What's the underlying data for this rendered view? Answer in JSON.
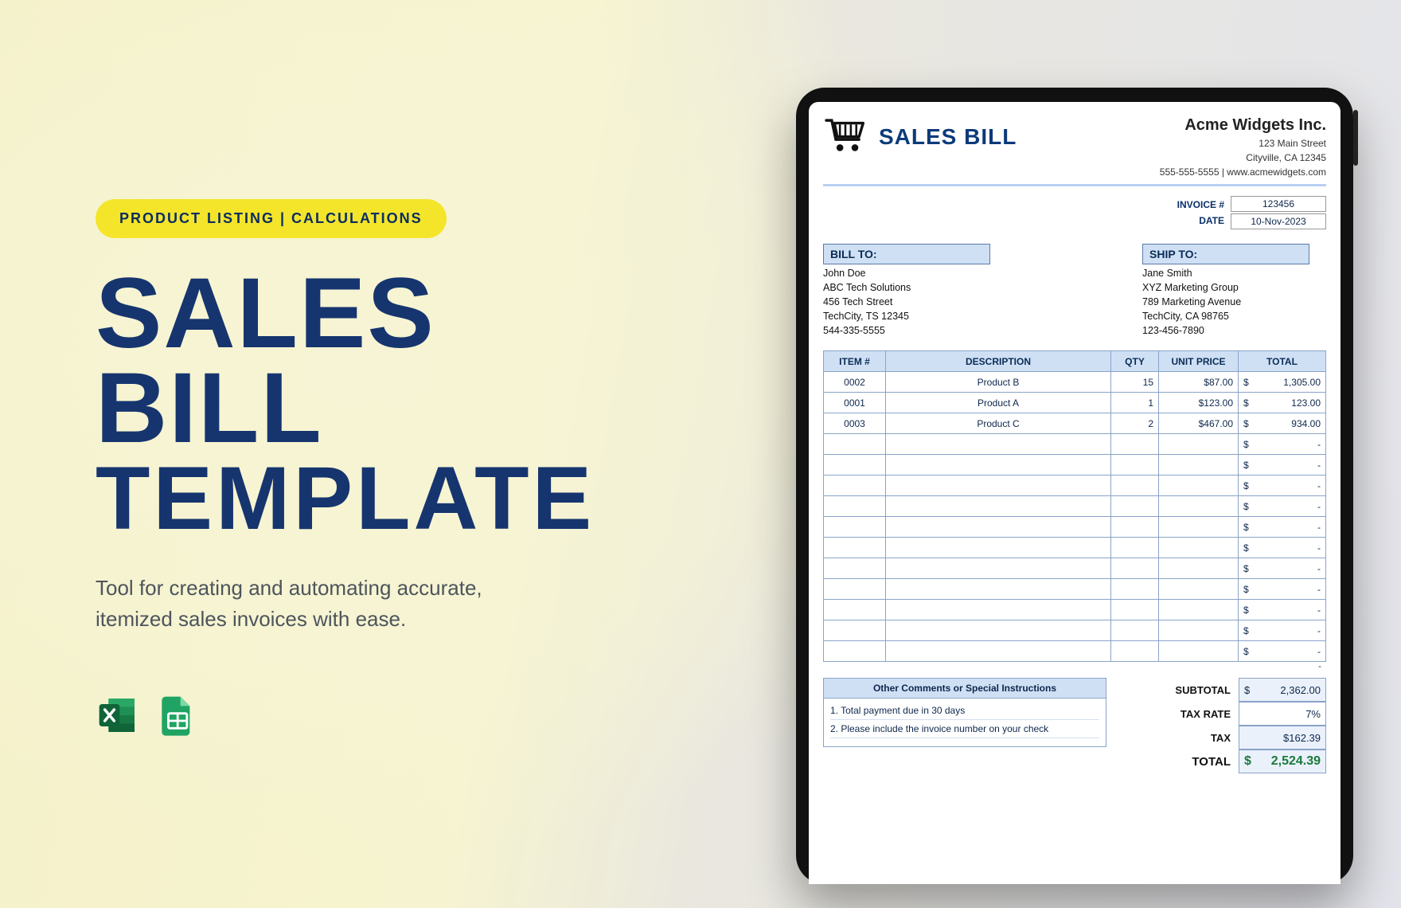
{
  "promo": {
    "pill": "PRODUCT LISTING  |  CALCULATIONS",
    "title_line1": "SALES BILL",
    "title_line2": "TEMPLATE",
    "subtitle": "Tool for creating and automating accurate, itemized sales invoices with ease."
  },
  "apps": {
    "a": "excel-icon",
    "b": "sheets-icon"
  },
  "doc": {
    "title": "SALES BILL",
    "company": {
      "name": "Acme Widgets Inc.",
      "street": "123 Main Street",
      "citystate": "Cityville, CA 12345",
      "contact": "555-555-5555 | www.acmewidgets.com"
    },
    "meta": {
      "invoice_label": "INVOICE #",
      "date_label": "DATE",
      "invoice_no": "123456",
      "date": "10-Nov-2023"
    },
    "billto": {
      "head": "BILL TO:",
      "name": "John Doe",
      "org": "ABC Tech Solutions",
      "street": "456 Tech Street",
      "citystate": "TechCity, TS 12345",
      "phone": "544-335-5555"
    },
    "shipto": {
      "head": "SHIP TO:",
      "name": "Jane Smith",
      "org": "XYZ Marketing Group",
      "street": "789 Marketing Avenue",
      "citystate": "TechCity, CA 98765",
      "phone": "123-456-7890"
    },
    "table": {
      "headers": {
        "item": "ITEM #",
        "desc": "DESCRIPTION",
        "qty": "QTY",
        "unit": "UNIT PRICE",
        "total": "TOTAL"
      },
      "rows": [
        {
          "item": "0002",
          "desc": "Product B",
          "qty": "15",
          "unit": "$87.00",
          "total": "1,305.00"
        },
        {
          "item": "0001",
          "desc": "Product A",
          "qty": "1",
          "unit": "$123.00",
          "total": "123.00"
        },
        {
          "item": "0003",
          "desc": "Product C",
          "qty": "2",
          "unit": "$467.00",
          "total": "934.00"
        }
      ],
      "blank_total": "-",
      "lead_note": "-"
    },
    "comments": {
      "head": "Other Comments or Special Instructions",
      "l1": "1. Total payment due in 30 days",
      "l2": "2. Please include the invoice number on your check"
    },
    "summary": {
      "subtotal_label": "SUBTOTAL",
      "subtotal": "2,362.00",
      "taxrate_label": "TAX RATE",
      "taxrate": "7%",
      "tax_label": "TAX",
      "tax": "$162.39",
      "total_label": "TOTAL",
      "total": "2,524.39"
    }
  }
}
